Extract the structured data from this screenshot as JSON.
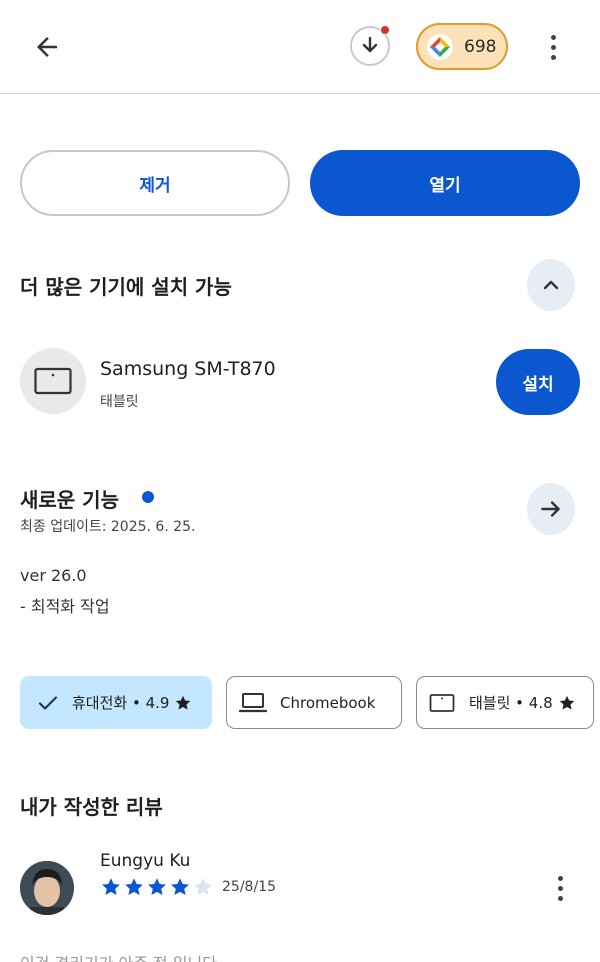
{
  "header": {
    "points": "698"
  },
  "actions": {
    "remove_label": "제거",
    "open_label": "열기"
  },
  "more_devices": {
    "title": "더 많은 기기에 설치 가능",
    "device_name": "Samsung SM-T870",
    "device_type": "태블릿",
    "install_label": "설치"
  },
  "whats_new": {
    "title": "새로운 기능",
    "updated": "최종 업데이트: 2025. 6. 25.",
    "notes": [
      "ver 26.0",
      "- 최적화 작업"
    ]
  },
  "chips": {
    "phone": "휴대전화 • 4.9",
    "chromebook": "Chromebook",
    "tablet": "태블릿 • 4.8"
  },
  "my_review": {
    "title": "내가 작성한 리뷰",
    "reviewer": "Eungyu Ku",
    "rating": 4,
    "max_rating": 5,
    "date": "25/8/15",
    "text": "이건 경리기가 아주 정 입니다"
  },
  "colors": {
    "accent": "#0b57d0",
    "chip_selected": "#c3e7ff",
    "points_bg": "#fde1b8",
    "points_border": "#e29a2c"
  },
  "icons": [
    "arrow-back-icon",
    "download-icon",
    "play-points-icon",
    "more-vert-icon",
    "chevron-up-icon",
    "tablet-icon",
    "arrow-forward-icon",
    "check-icon",
    "star-icon",
    "laptop-icon"
  ]
}
